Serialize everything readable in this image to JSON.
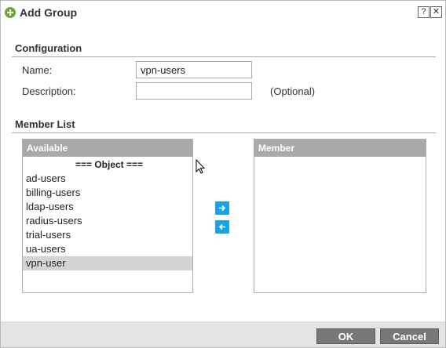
{
  "window": {
    "title": "Add Group",
    "help_glyph": "?",
    "close_glyph": "✕",
    "icon": "add-circle-icon"
  },
  "configuration": {
    "section_title": "Configuration",
    "name_label": "Name:",
    "name_value": "vpn-users",
    "description_label": "Description:",
    "description_value": "",
    "description_hint": "(Optional)"
  },
  "member_list": {
    "section_title": "Member List",
    "available": {
      "header": "Available",
      "group_label": "=== Object ===",
      "items": [
        "ad-users",
        "billing-users",
        "ldap-users",
        "radius-users",
        "trial-users",
        "ua-users",
        "vpn-user"
      ],
      "selected": "vpn-user"
    },
    "member": {
      "header": "Member",
      "items": []
    },
    "move_right_icon": "arrow-right-icon",
    "move_left_icon": "arrow-left-icon"
  },
  "footer": {
    "ok_label": "OK",
    "cancel_label": "Cancel"
  },
  "colors": {
    "accent": "#1aa2e6",
    "add_icon": "#6aa834",
    "list_header": "#a9a9a9",
    "button": "#777777",
    "selected_row": "#d4d4d4"
  }
}
